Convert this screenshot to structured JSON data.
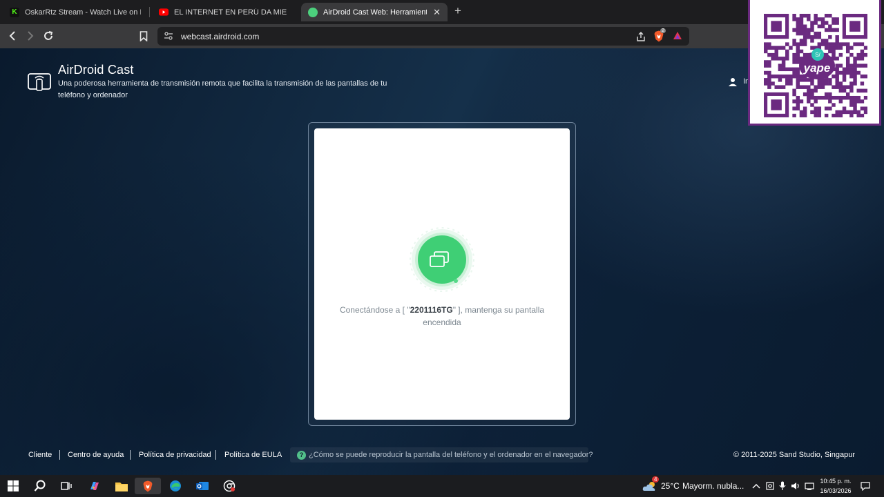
{
  "browser": {
    "tabs": [
      {
        "title": "OskarRtz Stream - Watch Live on Kick",
        "icon": "kick-icon",
        "color": "#53fc18"
      },
      {
        "title": "EL INTERNET EN PERÚ DA MIEDO - Y",
        "icon": "youtube-icon",
        "color": "#ff0000"
      },
      {
        "title": "AirDroid Cast Web: Herramienta",
        "icon": "airdroid-icon",
        "color": "#4cd07d",
        "active": true
      }
    ],
    "url": "webcast.airdroid.com",
    "shields_count": "2"
  },
  "page": {
    "brand": "AirDroid Cast",
    "tagline": "Una poderosa herramienta de transmisión remota que facilita la transmisión de las pantallas de tu teléfono y ordenador",
    "user_label": "In",
    "status_prefix": "Conectándose a [ \"",
    "device_code": "2201116TG",
    "status_suffix": "\" ], mantenga su pantalla encendida",
    "accent": "#3fcf75"
  },
  "footer": {
    "links": [
      "Cliente",
      "Centro de ayuda",
      "Política de privacidad",
      "Política de EULA"
    ],
    "help_text": "¿Cómo se puede reproducir la pantalla del teléfono y el ordenador en el navegador?",
    "copyright": "© 2011-2025 Sand Studio, Singapur"
  },
  "overlay": {
    "qr_brand": "yape",
    "qr_badge": "S/",
    "color": "#6b2a80"
  },
  "taskbar": {
    "apps": [
      "start-icon",
      "search-icon",
      "task-view-icon",
      "copilot-icon",
      "file-explorer-icon",
      "brave-icon",
      "edge-icon",
      "outlook-icon",
      "chrome-icon"
    ],
    "weather_temp": "25°C",
    "weather_text": "Mayorm. nubla...",
    "weather_badge": "4",
    "time": "10:45 p. m.",
    "date": "16/03/2026"
  }
}
